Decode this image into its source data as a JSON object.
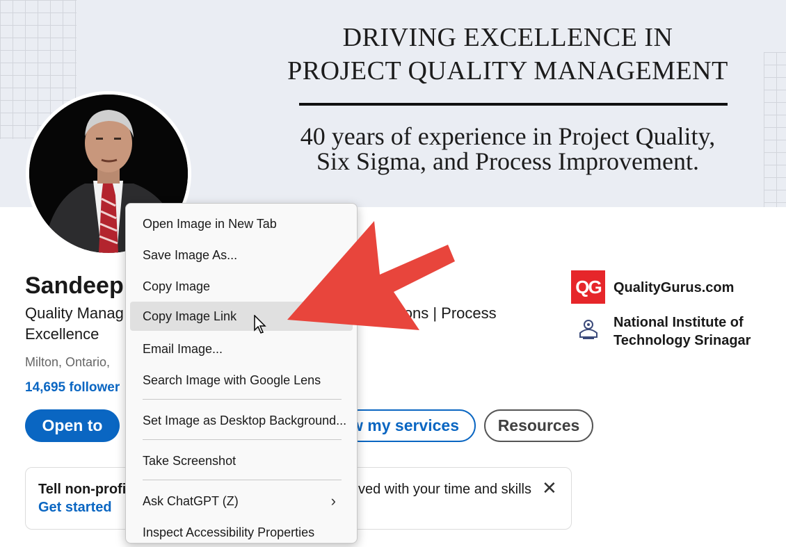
{
  "banner": {
    "title_line1": "DRIVING EXCELLENCE IN",
    "title_line2": "PROJECT QUALITY MANAGEMENT",
    "subtitle_line1": "40 years of experience in Project Quality,",
    "subtitle_line2": "Six Sigma, and Process Improvement."
  },
  "profile": {
    "name": "Sandeep",
    "headline_left": "Quality Manag",
    "headline_right": "isions | Process",
    "headline_line2": "Excellence",
    "location": "Milton, Ontario,",
    "followers": "14,695 follower"
  },
  "actions": {
    "open_to": "Open to",
    "services": "w my services",
    "resources": "Resources"
  },
  "companies": [
    {
      "logo_text": "QG",
      "name": "QualityGurus.com"
    },
    {
      "name_line1": "National Institute of",
      "name_line2": "Technology Srinagar"
    }
  ],
  "card": {
    "text_left": "Tell non-profi",
    "text_right": "ved with your time and skills",
    "link": "Get started",
    "close": "✕"
  },
  "context_menu": {
    "items": [
      {
        "label": "Open Image in New Tab"
      },
      {
        "label": "Save Image As..."
      },
      {
        "label": "Copy Image"
      },
      {
        "label": "Copy Image Link",
        "active": true
      },
      {
        "label": "Email Image..."
      },
      {
        "label": "Search Image with Google Lens"
      },
      {
        "label": "Set Image as Desktop Background..."
      },
      {
        "label": "Take Screenshot"
      },
      {
        "label": "Ask ChatGPT (Z)",
        "chevron": "›"
      },
      {
        "label": "Inspect Accessibility Properties"
      }
    ]
  },
  "colors": {
    "brand_blue": "#0a66c2",
    "arrow_red": "#e8453c",
    "qg_red": "#e6262a",
    "banner_bg": "#eaedf3"
  }
}
